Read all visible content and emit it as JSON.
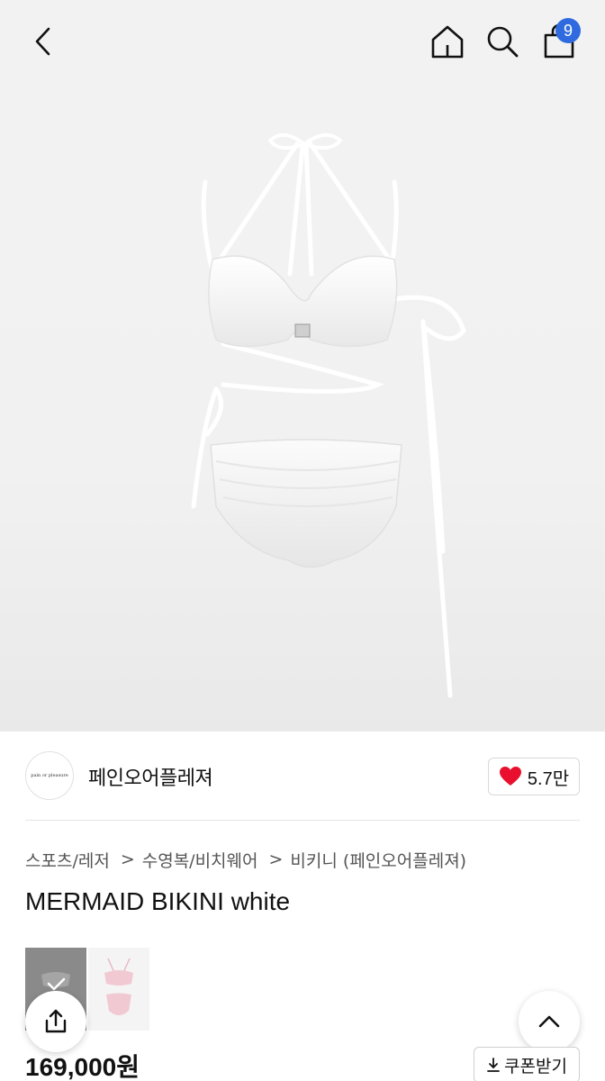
{
  "header": {
    "back_icon": "chevron-left-icon",
    "home_icon": "home-icon",
    "search_icon": "search-icon",
    "cart_icon": "shopping-bag-icon",
    "cart_badge": "9",
    "badge_color": "#2f6bdf"
  },
  "product_image": {
    "description_icon": "white-halter-bikini-image"
  },
  "brand": {
    "logo_text": "pain or pleasure",
    "name": "페인오어플레져",
    "like_icon": "heart-icon",
    "like_color": "#e8102e",
    "like_count": "5.7만"
  },
  "breadcrumb": {
    "items": [
      "스포츠/레저",
      "수영복/비치웨어",
      "비키니 (페인오어플레져)"
    ],
    "separator": ">"
  },
  "product": {
    "title": "MERMAID BIKINI white",
    "price": "169,000원"
  },
  "actions": {
    "coupon_label": "쿠폰받기",
    "coupon_icon": "download-icon",
    "share_icon": "share-icon",
    "scroll_top_icon": "chevron-up-icon"
  }
}
